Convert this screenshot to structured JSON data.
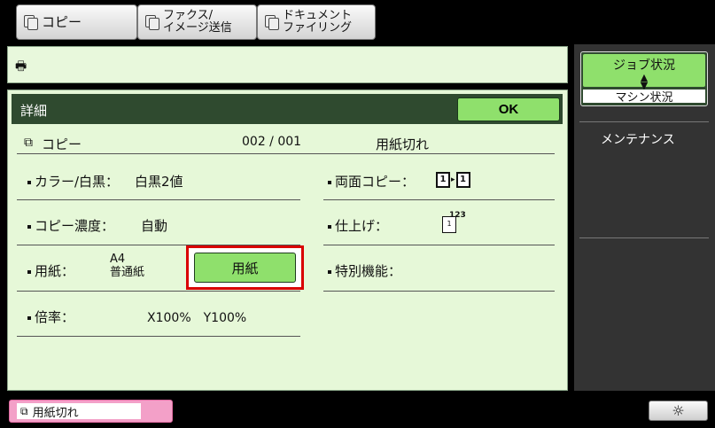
{
  "tabs": [
    {
      "label": "コピー"
    },
    {
      "label": "ファクス/\nイメージ送信"
    },
    {
      "label": "ドキュメント\nファイリング"
    }
  ],
  "message_bar": {
    "text": ""
  },
  "detail": {
    "title": "詳細",
    "ok_label": "OK",
    "job_type": "コピー",
    "counter": "002 / 001",
    "status": "用紙切れ",
    "settings": {
      "color_label": "カラー/白黒：",
      "color_value": "白黒2値",
      "duplex_label": "両面コピー：",
      "density_label": "コピー濃度：",
      "density_value": "自動",
      "finish_label": "仕上げ：",
      "paper_label": "用紙：",
      "paper_size": "A4",
      "paper_type": "普通紙",
      "paper_button": "用紙",
      "special_label": "特別機能：",
      "ratio_label": "倍率：",
      "ratio_value": "X100%　Y100%"
    }
  },
  "right_panel": {
    "job_status": "ジョブ状況",
    "machine_status": "マシン状況",
    "maintenance": "メンテナンス"
  },
  "bottom": {
    "status_text": "用紙切れ",
    "brightness_icon": "sun-icon"
  },
  "colors": {
    "accent_green": "#8fe06c",
    "panel_bg": "#e6f8d8",
    "titlebar": "#2f4a2f",
    "highlight_red": "#d90000",
    "status_pink": "#f3a0c8"
  }
}
